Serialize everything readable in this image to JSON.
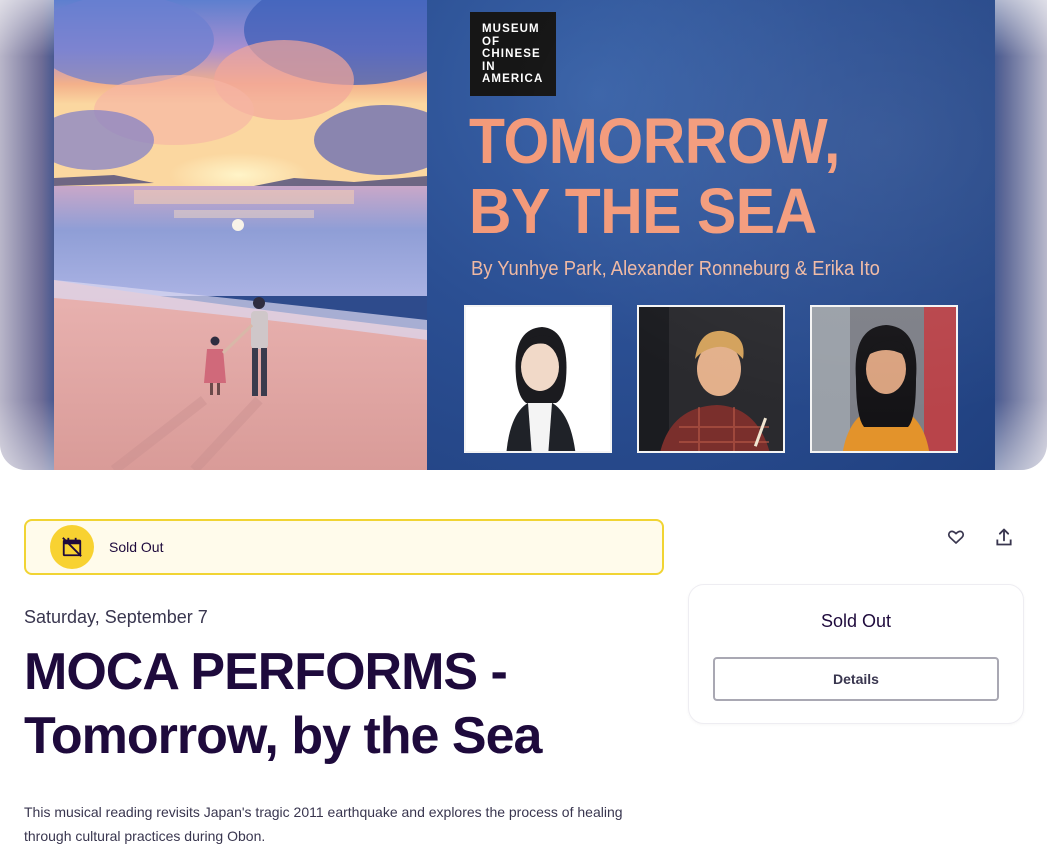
{
  "hero": {
    "logo_lines": [
      "MUSEUM",
      "OF",
      "CHINESE",
      "IN",
      "AMERICA"
    ],
    "poster_title_lines": [
      "TOMORROW,",
      "BY THE SEA"
    ],
    "poster_byline": "By Yunhye Park, Alexander Ronneburg & Erika Ito",
    "headshots": [
      "headshot-1",
      "headshot-2",
      "headshot-3"
    ]
  },
  "status": {
    "label": "Sold Out",
    "icon": "calendar-off-icon",
    "accent": "#f8d231",
    "border": "#f1d433",
    "background": "#fffbeb"
  },
  "actions": {
    "like_icon": "heart-icon",
    "share_icon": "share-icon"
  },
  "event": {
    "date": "Saturday, September 7",
    "title": "MOCA PERFORMS - Tomorrow, by the Sea",
    "summary": "This musical reading revisits Japan's tragic 2011 earthquake and explores the process of healing through cultural practices during Obon."
  },
  "ticket": {
    "status": "Sold Out",
    "button_label": "Details"
  },
  "colors": {
    "title": "#1e0a3c",
    "poster_title": "#f39a7a",
    "poster_background": "#2b4f93"
  }
}
